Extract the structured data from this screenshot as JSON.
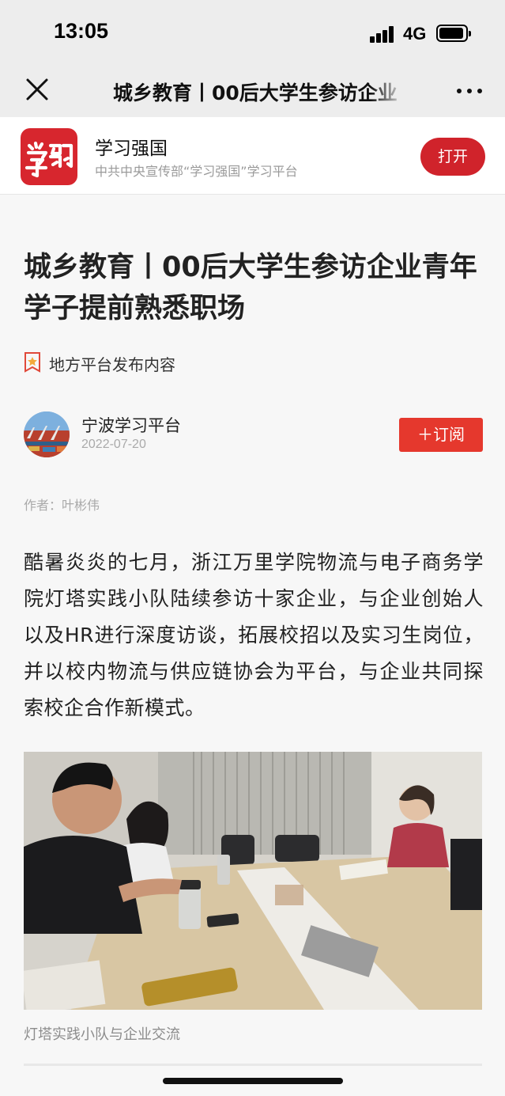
{
  "status_bar": {
    "time": "13:05",
    "network": "4G",
    "signal_icon": "cellular-signal-icon",
    "battery_icon": "battery-icon",
    "battery_level": 0.95
  },
  "nav": {
    "title": "城乡教育丨00后大学生参访企业 青年学子提前熟悉职场",
    "close_icon": "close-icon",
    "more_icon": "more-dots-icon"
  },
  "app_banner": {
    "name": "学习强国",
    "description": "中共中央宣传部“学习强国”学习平台",
    "open_label": "打开",
    "accent": "#d0232b"
  },
  "article": {
    "title": "城乡教育丨00后大学生参访企业青年学子提前熟悉职场",
    "source_tag": "地方平台发布内容",
    "author": "宁波学习平台",
    "date": "2022-07-20",
    "subscribe_label": "＋订阅",
    "byline": "作者：叶彬伟",
    "body": "酷暑炎炎的七月，浙江万里学院物流与电子商务学院灯塔实践小队陆续参访十家企业，与企业创始人以及HR进行深度访谈，拓展校招以及实习生岗位，并以校内物流与供应链协会为平台，与企业共同探索校企合作新模式。",
    "photo_caption": "灯塔实践小队与企业交流"
  }
}
